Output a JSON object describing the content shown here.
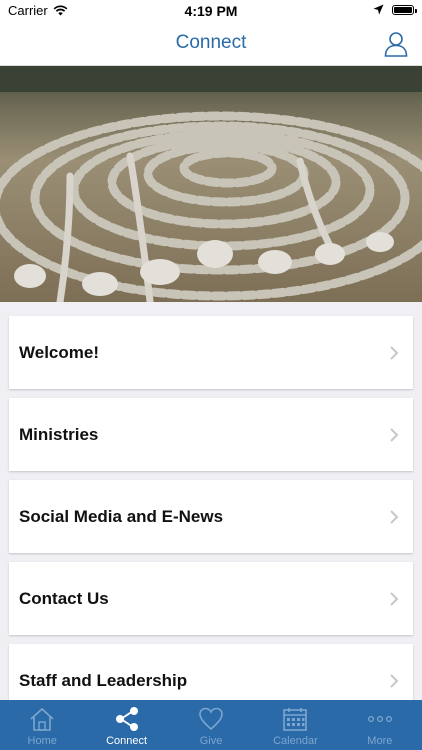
{
  "status_bar": {
    "carrier": "Carrier",
    "time": "4:19 PM"
  },
  "header": {
    "title": "Connect",
    "profile_icon": "person-icon"
  },
  "hero": {
    "description_icon": "stone-labyrinth-photo"
  },
  "menu": {
    "items": [
      {
        "label": "Welcome!"
      },
      {
        "label": "Ministries"
      },
      {
        "label": "Social Media and E-News"
      },
      {
        "label": "Contact Us"
      },
      {
        "label": "Staff and Leadership"
      }
    ]
  },
  "tabs": [
    {
      "label": "Home",
      "icon": "home-icon",
      "active": false
    },
    {
      "label": "Connect",
      "icon": "share-icon",
      "active": true
    },
    {
      "label": "Give",
      "icon": "heart-icon",
      "active": false
    },
    {
      "label": "Calendar",
      "icon": "calendar-icon",
      "active": false
    },
    {
      "label": "More",
      "icon": "more-dots-icon",
      "active": false
    }
  ],
  "colors": {
    "accent": "#2a6aa8",
    "tab_inactive": "#7da6cf",
    "background": "#efeff4"
  }
}
